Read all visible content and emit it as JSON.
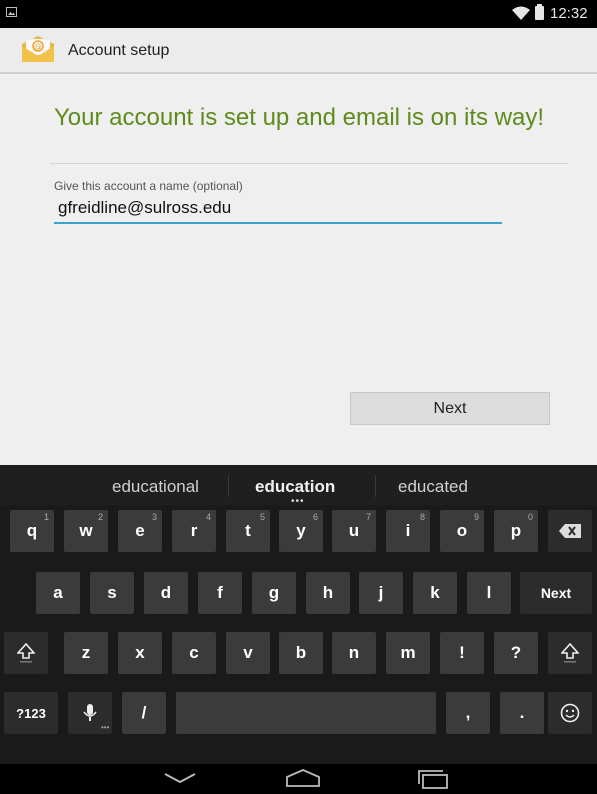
{
  "status_bar": {
    "time": "12:32"
  },
  "action_bar": {
    "title": "Account setup"
  },
  "content": {
    "headline": "Your account is set up and email is on its way!",
    "field_label": "Give this account a name (optional)",
    "name_value": "gfreidline@sulross.edu",
    "next_label": "Next"
  },
  "keyboard": {
    "suggestions": [
      "educational",
      "education",
      "educated"
    ],
    "row1": [
      {
        "label": "q",
        "hint": "1"
      },
      {
        "label": "w",
        "hint": "2"
      },
      {
        "label": "e",
        "hint": "3"
      },
      {
        "label": "r",
        "hint": "4"
      },
      {
        "label": "t",
        "hint": "5"
      },
      {
        "label": "y",
        "hint": "6"
      },
      {
        "label": "u",
        "hint": "7"
      },
      {
        "label": "i",
        "hint": "8"
      },
      {
        "label": "o",
        "hint": "9"
      },
      {
        "label": "p",
        "hint": "0"
      }
    ],
    "row2": [
      "a",
      "s",
      "d",
      "f",
      "g",
      "h",
      "j",
      "k",
      "l"
    ],
    "row2_action": "Next",
    "row3": [
      "z",
      "x",
      "c",
      "v",
      "b",
      "n",
      "m",
      "!",
      "?"
    ],
    "row4": {
      "symbols": "?123",
      "slash": "/",
      "comma": ",",
      "period": "."
    }
  },
  "colors": {
    "headline": "#5f8a1c",
    "input_underline": "#39a3c9"
  }
}
